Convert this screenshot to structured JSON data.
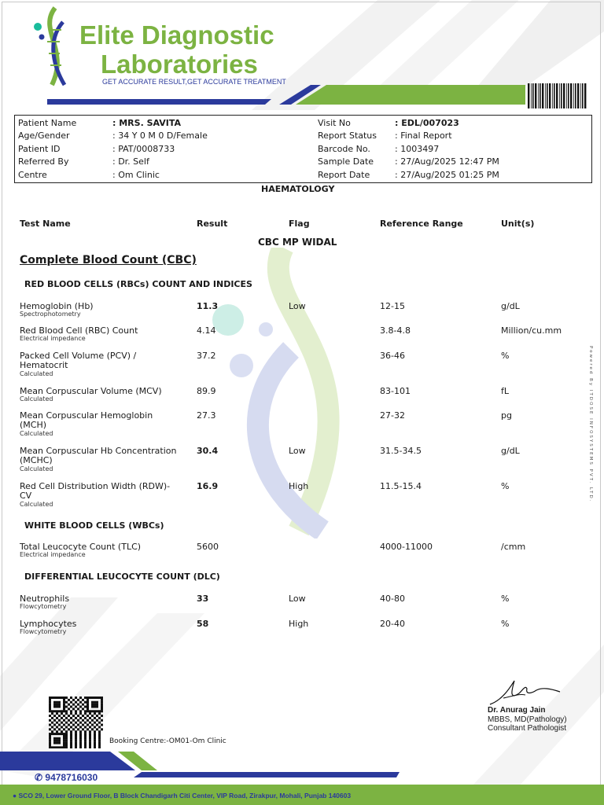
{
  "header": {
    "lab_name_line1": "Elite Diagnostic",
    "lab_name_line2": "Laboratories",
    "tagline": "GET ACCURATE RESULT,GET ACCURATE TREATMENT"
  },
  "patient": {
    "name_label": "Patient Name",
    "name_value": ": MRS. SAVITA",
    "age_label": "Age/Gender",
    "age_value": ": 34 Y 0 M 0 D/Female",
    "id_label": "Patient ID",
    "id_value": ": PAT/0008733",
    "ref_label": "Referred By",
    "ref_value": ": Dr. Self",
    "centre_label": "Centre",
    "centre_value": ": Om Clinic",
    "visit_label": "Visit No",
    "visit_value": ": EDL/007023",
    "status_label": "Report Status",
    "status_value": ": Final Report",
    "barcode_label": "Barcode No.",
    "barcode_value": ": 1003497",
    "sample_label": "Sample Date",
    "sample_value": ": 27/Aug/2025 12:47 PM",
    "report_label": "Report Date",
    "report_value": ": 27/Aug/2025 01:25 PM"
  },
  "department": "HAEMATOLOGY",
  "columns": {
    "test": "Test Name",
    "result": "Result",
    "flag": "Flag",
    "range": "Reference Range",
    "unit": "Unit(s)"
  },
  "panel_name": "CBC MP WIDAL",
  "section_title": "Complete Blood Count (CBC)",
  "groups": {
    "rbc": "RED BLOOD CELLS (RBCs) COUNT AND INDICES",
    "wbc": "WHITE BLOOD CELLS (WBCs)",
    "dlc": "DIFFERENTIAL LEUCOCYTE COUNT (DLC)"
  },
  "tests": [
    {
      "name": "Hemoglobin (Hb)",
      "method": "Spectrophotometry",
      "result": "11.3",
      "flag": "Low",
      "range": "12-15",
      "unit": "g/dL"
    },
    {
      "name": "Red Blood Cell (RBC) Count",
      "method": "Electrical impedance",
      "result": "4.14",
      "flag": "",
      "range": "3.8-4.8",
      "unit": "Million/cu.mm"
    },
    {
      "name": "Packed Cell Volume (PCV) /",
      "name2": "Hematocrit",
      "method": "Calculated",
      "result": "37.2",
      "flag": "",
      "range": "36-46",
      "unit": "%"
    },
    {
      "name": "Mean Corpuscular Volume (MCV)",
      "method": "Calculated",
      "result": "89.9",
      "flag": "",
      "range": "83-101",
      "unit": "fL"
    },
    {
      "name": "Mean Corpuscular Hemoglobin",
      "name2": "(MCH)",
      "method": "Calculated",
      "result": "27.3",
      "flag": "",
      "range": "27-32",
      "unit": "pg"
    },
    {
      "name": "Mean Corpuscular Hb Concentration",
      "name2": "(MCHC)",
      "method": "Calculated",
      "result": "30.4",
      "flag": "Low",
      "range": "31.5-34.5",
      "unit": "g/dL"
    },
    {
      "name": "Red Cell Distribution Width (RDW)-",
      "name2": "CV",
      "method": "Calculated",
      "result": "16.9",
      "flag": "High",
      "range": "11.5-15.4",
      "unit": "%"
    },
    {
      "name": "Total Leucocyte Count (TLC)",
      "method": "Electrical impedance",
      "result": "5600",
      "flag": "",
      "range": "4000-11000",
      "unit": "/cmm"
    },
    {
      "name": "Neutrophils",
      "method": "Flowcytometry",
      "result": "33",
      "flag": "Low",
      "range": "40-80",
      "unit": "%"
    },
    {
      "name": "Lymphocytes",
      "method": "Flowcytometry",
      "result": "58",
      "flag": "High",
      "range": "20-40",
      "unit": "%"
    }
  ],
  "side_text": "Powered By ITDOSE INFOSYSTEMS PVT. LTD.",
  "booking": "Booking Centre:-OM01-Om Clinic",
  "signatory": {
    "name": "Dr. Anurag Jain",
    "degree": "MBBS, MD(Pathology)",
    "title": "Consultant Pathologist"
  },
  "footer": {
    "phone": "9478716030",
    "address": "SCO 29, Lower Ground Floor, B Block Chandigarh Citi Center, VIP Road, Zirakpur, Mohali, Punjab 140603"
  },
  "colors": {
    "brand_green": "#7cb342",
    "brand_blue": "#2b3a9c"
  }
}
